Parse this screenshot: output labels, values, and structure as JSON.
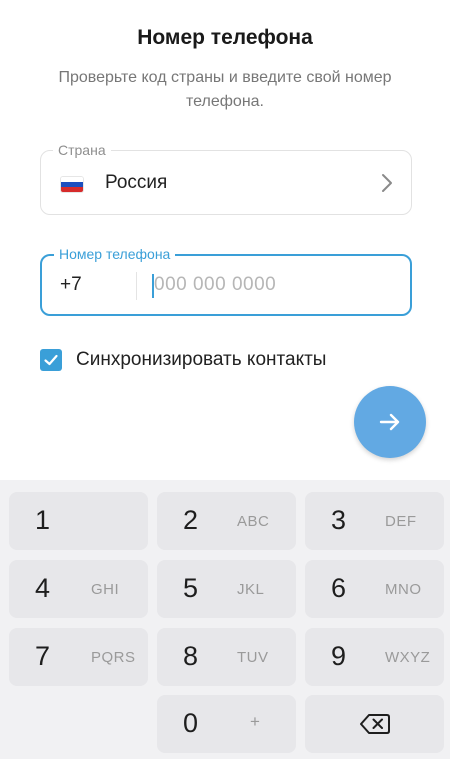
{
  "header": {
    "title": "Номер телефона",
    "subtitle": "Проверьте код страны и введите свой номер телефона."
  },
  "country_field": {
    "legend": "Страна",
    "value": "Россия",
    "flag_colors": [
      "#ffffff",
      "#1c4fbf",
      "#d62b2b"
    ]
  },
  "phone_field": {
    "legend": "Номер телефона",
    "country_code": "+7",
    "value": "",
    "placeholder": "000 000 0000"
  },
  "sync": {
    "label": "Синхронизировать контакты",
    "checked": true
  },
  "next_button": {
    "icon": "arrow-right-icon"
  },
  "keypad": {
    "keys": [
      {
        "digit": "1",
        "letters": ""
      },
      {
        "digit": "2",
        "letters": "ABC"
      },
      {
        "digit": "3",
        "letters": "DEF"
      },
      {
        "digit": "4",
        "letters": "GHI"
      },
      {
        "digit": "5",
        "letters": "JKL"
      },
      {
        "digit": "6",
        "letters": "MNO"
      },
      {
        "digit": "7",
        "letters": "PQRS"
      },
      {
        "digit": "8",
        "letters": "TUV"
      },
      {
        "digit": "9",
        "letters": "WXYZ"
      },
      {
        "digit": "0",
        "letters": "+"
      }
    ],
    "backspace_icon": "backspace-icon"
  },
  "colors": {
    "accent": "#3a9fd8",
    "fab": "#62a9e3",
    "key_bg": "#e7e7ea",
    "keypad_bg": "#f1f1f3"
  }
}
